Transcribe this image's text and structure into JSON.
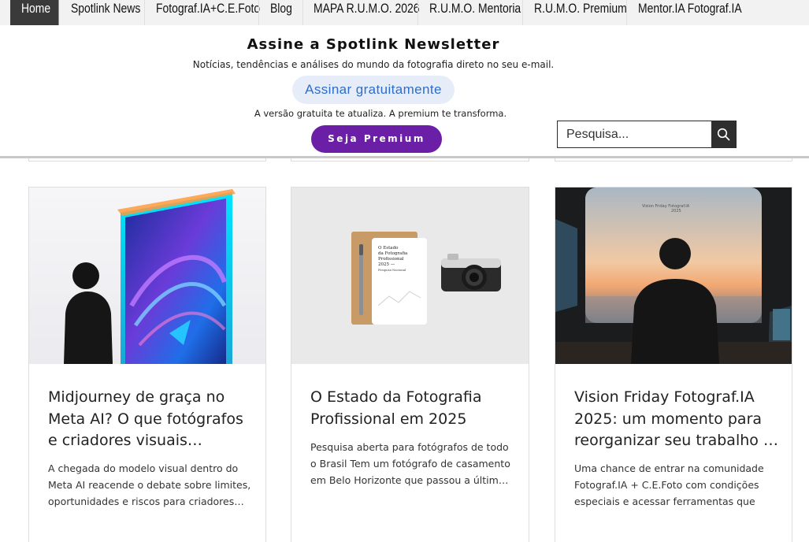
{
  "nav": {
    "items": [
      {
        "label": "Home",
        "active": true
      },
      {
        "label": "Spotlink News",
        "active": false
      },
      {
        "label": "Fotograf.IA+C.E.Foto",
        "active": false
      },
      {
        "label": "Blog",
        "active": false
      },
      {
        "label": "MAPA R.U.M.O. 2026",
        "active": false
      },
      {
        "label": "R.U.M.O. Mentoria",
        "active": false
      },
      {
        "label": "R.U.M.O. Premium",
        "active": false
      },
      {
        "label": "Mentor.IA Fotograf.IA",
        "active": false
      }
    ]
  },
  "newsletter": {
    "title": "Assine a Spotlink Newsletter",
    "subtitle": "Notícias, tendências e análises do mundo da fotografia direto no seu e-mail.",
    "free_button": "Assinar gratuitamente",
    "note": "A versão gratuita te atualiza. A premium te transforma.",
    "premium_button": "Seja Premium"
  },
  "search": {
    "placeholder": "Pesquisa..."
  },
  "colors": {
    "nav_background": "#f2f2f2",
    "nav_active": "#3a3a3a",
    "free_button_bg": "#e6ecf8",
    "free_button_text": "#2d6ec9",
    "premium_button_bg": "#6a1fa6"
  },
  "posts": [
    {
      "title": "Midjourney de graça no Meta AI? O que fotógrafos e criadores visuais precisam saber",
      "excerpt": "A chegada do modelo visual dentro do Meta AI reacende o debate sobre limites, oportunidades e riscos para criadores visuais"
    },
    {
      "title": "O Estado da Fotografia Profissional em 2025",
      "excerpt": "Pesquisa aberta para fotógrafos de todo o Brasil Tem um fotógrafo de casamento em Belo Horizonte que passou a últimos anos",
      "image_notebook_text": [
        "O Estado",
        "da Fotografia",
        "Profissional",
        "2025 —",
        "Pesquisa Nacional"
      ]
    },
    {
      "title": "Vision Friday Fotograf.IA 2025: um momento para reorganizar seu trabalho e planejar",
      "excerpt": "Uma chance de entrar na comunidade Fotograf.IA + C.E.Foto com condições especiais e acessar ferramentas que",
      "image_overlay_text": [
        "Vision Friday Fotograf.IA",
        "2025"
      ]
    }
  ]
}
